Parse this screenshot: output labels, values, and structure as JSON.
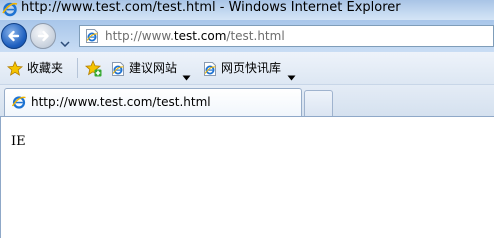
{
  "window": {
    "title": "http://www.test.com/test.html - Windows Internet Explorer"
  },
  "navigation": {
    "back_icon": "back-arrow-icon",
    "forward_icon": "forward-arrow-icon",
    "dropdown_icon": "chevron-down-icon"
  },
  "address_bar": {
    "prefix": "http://www.",
    "domain": "test.com",
    "path": "/test.html",
    "page_icon": "ie-page-icon"
  },
  "favorites_bar": {
    "favorites_label": "收藏夹",
    "favorites_icon": "star-icon",
    "add_icon": "add-favorites-icon",
    "links": [
      {
        "label": "建议网站",
        "icon": "ie-page-icon"
      },
      {
        "label": "网页快讯库",
        "icon": "ie-page-icon"
      }
    ]
  },
  "tabs": {
    "active_title": "http://www.test.com/test.html",
    "new_tab_icon": "new-tab-icon"
  },
  "content": {
    "text": "IE"
  },
  "colors": {
    "title_bar": "#b8d0ee",
    "address_border": "#7f9db9",
    "back_button": "#1d5fbf"
  }
}
